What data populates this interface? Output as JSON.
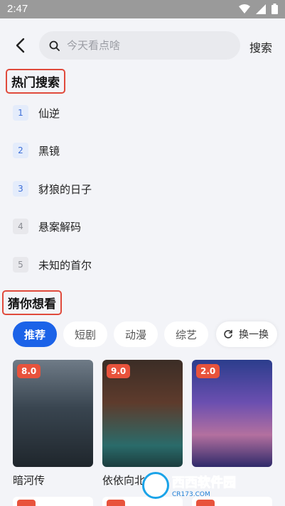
{
  "status": {
    "time": "2:47"
  },
  "search": {
    "placeholder": "今天看点啥",
    "button": "搜索"
  },
  "hot": {
    "title": "热门搜索",
    "items": [
      {
        "rank": "1",
        "text": "仙逆"
      },
      {
        "rank": "2",
        "text": "黑镜"
      },
      {
        "rank": "3",
        "text": "豺狼的日子"
      },
      {
        "rank": "4",
        "text": "悬案解码"
      },
      {
        "rank": "5",
        "text": "未知的首尔"
      }
    ]
  },
  "guess": {
    "title": "猜你想看",
    "tabs": [
      "推荐",
      "短剧",
      "动漫",
      "综艺"
    ],
    "refresh": "换一换",
    "cards": [
      {
        "score": "8.0",
        "title": "暗河传"
      },
      {
        "score": "9.0",
        "title": "依依向北风"
      },
      {
        "score": "2.0",
        "title": ""
      }
    ]
  },
  "watermark": {
    "text": "西西软件园",
    "url": "CR173.COM"
  },
  "colors": {
    "accent": "#1c63e8",
    "score": "#e8533c",
    "highlight_box": "#e04a3c"
  }
}
